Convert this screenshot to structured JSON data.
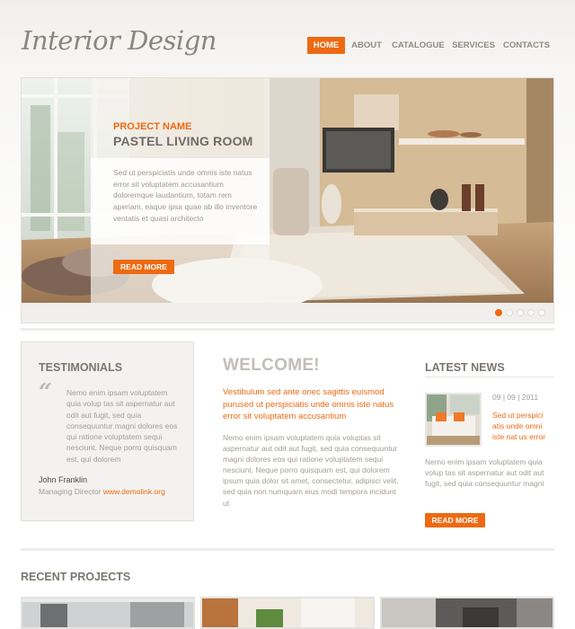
{
  "brand": {
    "logo": "Interior Design"
  },
  "nav": {
    "items": [
      {
        "label": "HOME",
        "active": true
      },
      {
        "label": "ABOUT",
        "active": false
      },
      {
        "label": "CATALOGUE",
        "active": false
      },
      {
        "label": "SERVICES",
        "active": false
      },
      {
        "label": "CONTACTS",
        "active": false
      }
    ]
  },
  "hero": {
    "label": "PROJECT NAME",
    "title": "PASTEL LIVING ROOM",
    "description": "Sed ut perspiciatis unde omnis iste natus error sit voluptatem accusantium doloremque laudantium, totam rem aperiam, eaque ipsa quae ab illo inventore ventatis et quasi architecto",
    "button": "READ MORE",
    "slides_total": 5,
    "active_slide": 1
  },
  "testimonials": {
    "title": "TESTIMONIALS",
    "quote_mark": "“",
    "text": "Nemo enim ipsam voluptatem quia volup tas sit aspernatur aut odit aut fugit, sed quia consequuntur magni dolores eos qui ratione voluptatem sequi nesciunt. Neque porro quisquam est, qui dolorem",
    "author": "John Franklin",
    "role": "Managing Director",
    "link": "www.demolink.org"
  },
  "welcome": {
    "title": "WELCOME!",
    "lead": "Vestibulum sed ante onec sagittis euismod purused ut perspiciatis unde omnis iste natus error sit voluptatem accusantium",
    "body": "Nemo enim ipsam voluptatem quia voluptas sit aspernatur aut odit aut fugit, sed quia consequuntur magni dolores eos qui ratione voluptatem sequi nesciunt. Neque porro quisquam est, qui dolorem ipsum quia dolor sit amet, consectetur, adipisci velit, sed quia non numquam eius modi tempora incidunt ut"
  },
  "news": {
    "title": "LATEST NEWS",
    "date": "09 | 09 | 2011",
    "link": "Sed ut perspici atis unde omni iste nat us error",
    "body": "Nemo enim ipsam voluptatem quia volup tas sit aspernatur aut odit aut fugit, sed quia consequuntur magni",
    "button": "READ MORE"
  },
  "recent": {
    "title": "RECENT PROJECTS"
  },
  "colors": {
    "accent": "#ee6a12",
    "heading": "#7b7670",
    "body_text": "#a39d96",
    "panel_bg": "#f3f2f0"
  },
  "icons": [
    "quote-icon",
    "slider-dot-icon"
  ]
}
